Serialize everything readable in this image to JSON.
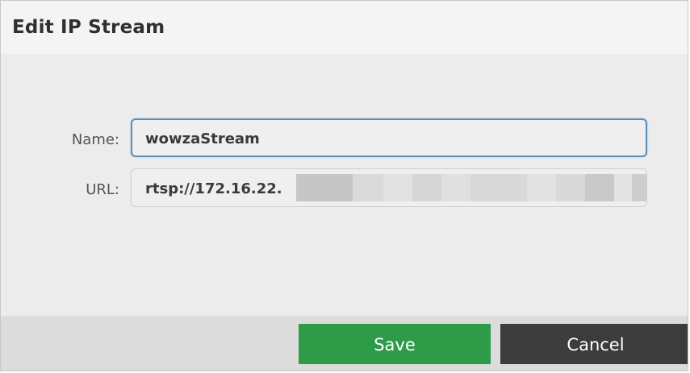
{
  "dialog": {
    "title": "Edit IP Stream"
  },
  "form": {
    "name_label": "Name:",
    "name_value": "wowzaStream",
    "url_label": "URL:",
    "url_value": "rtsp://172.16.22."
  },
  "footer": {
    "save_label": "Save",
    "cancel_label": "Cancel"
  },
  "colors": {
    "save": "#2e9b49",
    "cancel": "#3c3c3c",
    "focus_border": "#5a8fbf"
  }
}
